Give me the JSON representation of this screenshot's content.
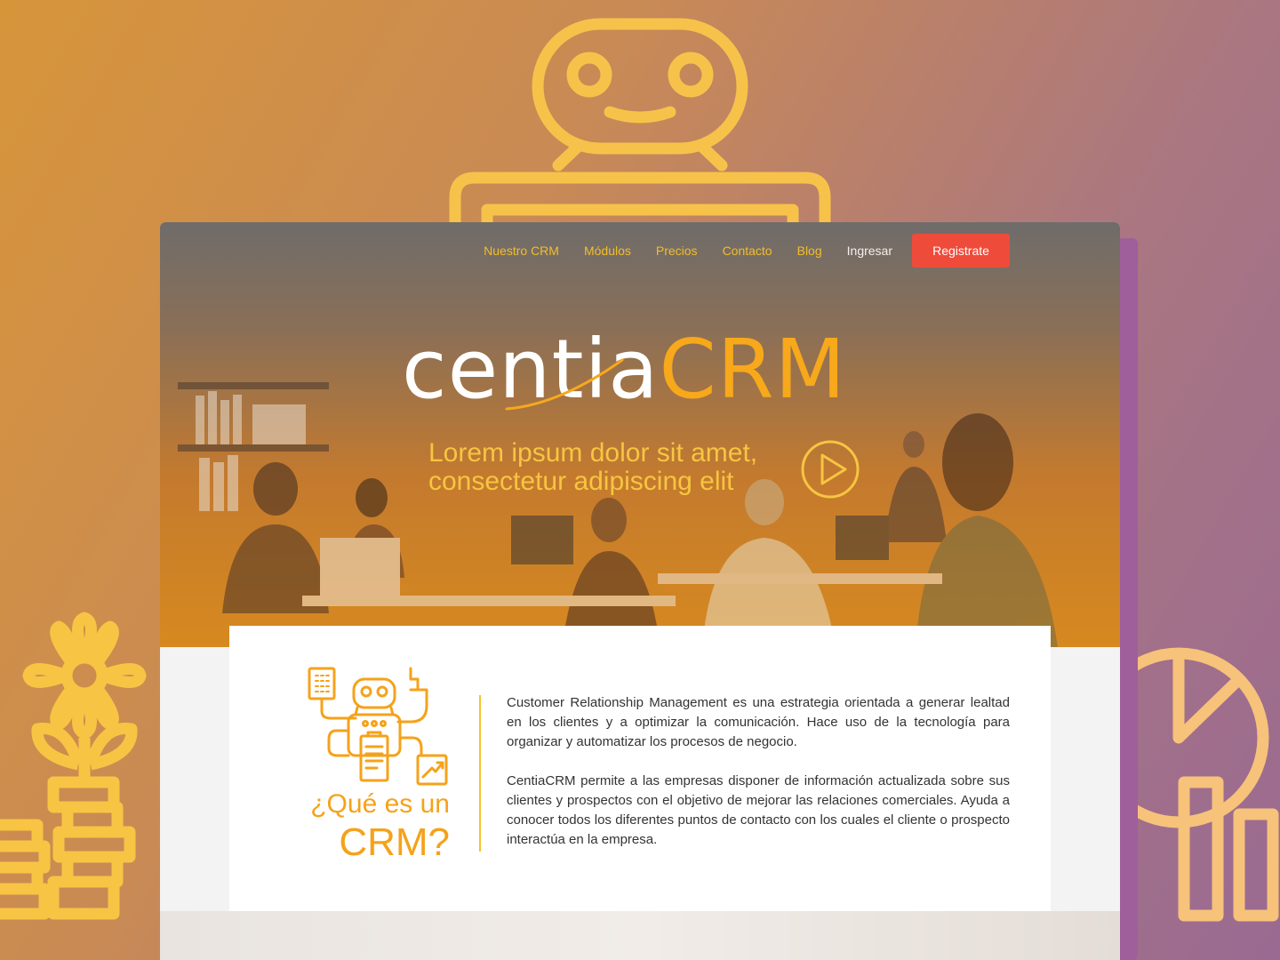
{
  "nav": {
    "items": [
      {
        "label": "Nuestro CRM"
      },
      {
        "label": "Módulos"
      },
      {
        "label": "Precios"
      },
      {
        "label": "Contacto"
      },
      {
        "label": "Blog"
      }
    ],
    "login_label": "Ingresar",
    "register_label": "Registrate"
  },
  "hero": {
    "logo_part1": "centia",
    "logo_part2": "CRM",
    "tagline_line1": "Lorem ipsum dolor sit amet,",
    "tagline_line2": "consectetur adipiscing elit"
  },
  "about": {
    "heading_line1": "¿Qué es un",
    "heading_line2": "CRM?",
    "paragraph1": "Customer Relationship Management es una estrategia orientada a generar lealtad en los clientes y a optimizar la comunicación. Hace uso de la tecnología para organizar y automatizar los procesos de negocio.",
    "paragraph2": "CentiaCRM permite a las empresas disponer de información actualizada sobre sus clientes y prospectos con el objetivo de mejorar las relaciones comerciales. Ayuda a conocer todos los diferentes puntos de contacto con los cuales el cliente o prospecto interactúa en la empresa."
  },
  "colors": {
    "accent_orange": "#f7a81b",
    "accent_yellow": "#f2bd2b",
    "register_red": "#ef4b3b"
  },
  "icons": [
    "robot-icon",
    "flower-pot-icon",
    "coin-stack-icon",
    "pie-chart-icon",
    "bar-chart-icon",
    "play-icon",
    "crm-robot-illustration"
  ]
}
